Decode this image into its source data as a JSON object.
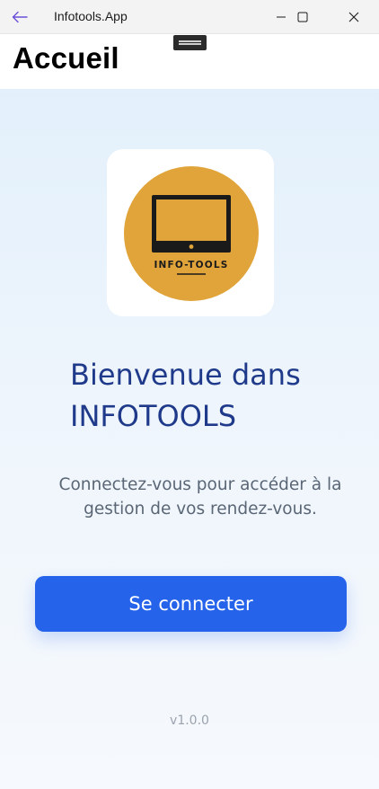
{
  "window": {
    "title": "Infotools.App",
    "controls": [
      "back-arrow-icon",
      "minimize-icon",
      "maximize-icon",
      "close-icon"
    ]
  },
  "header": {
    "title": "Accueil"
  },
  "logo": {
    "text": "INFO-TOOLS",
    "circle_color": "#e0a43a",
    "icon": "monitor-icon"
  },
  "main": {
    "welcome": "Bienvenue dans INFOTOOLS",
    "subtitle": "Connectez-vous pour accéder à la gestion de vos rendez-vous.",
    "login_button": "Se connecter",
    "version": "v1.0.0"
  },
  "colors": {
    "accent": "#2563eb",
    "heading": "#1f3a8a",
    "back_arrow": "#6b4fd8"
  }
}
